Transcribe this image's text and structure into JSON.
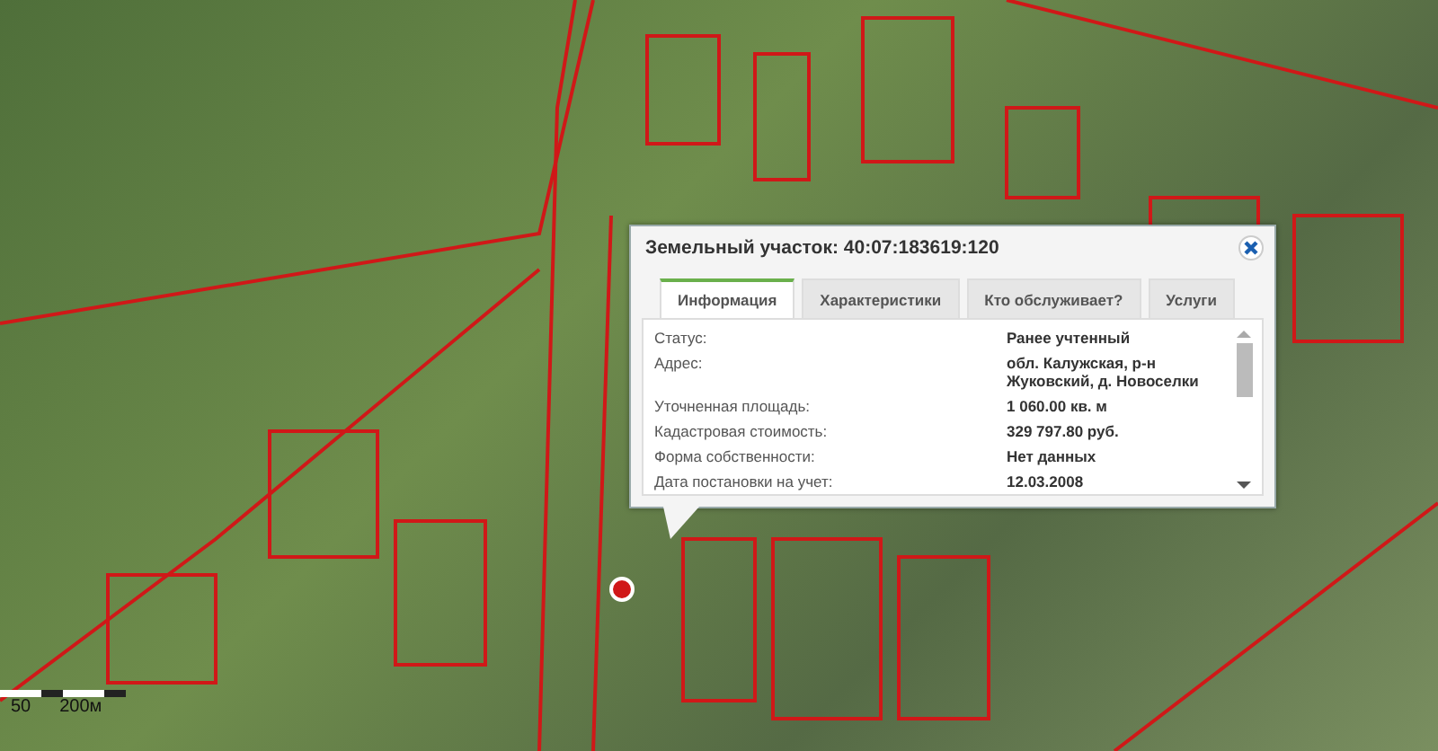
{
  "popup": {
    "title": "Земельный участок: 40:07:183619:120",
    "tabs": [
      {
        "label": "Информация",
        "selected": true
      },
      {
        "label": "Характеристики",
        "selected": false
      },
      {
        "label": "Кто обслуживает?",
        "selected": false
      },
      {
        "label": "Услуги",
        "selected": false
      }
    ],
    "rows": [
      {
        "label": "Статус:",
        "value": "Ранее учтенный"
      },
      {
        "label": "Адрес:",
        "value": "обл. Калужская, р-н Жуковский, д. Новоселки"
      },
      {
        "label": "Уточненная площадь:",
        "value": "1 060.00 кв. м"
      },
      {
        "label": "Кадастровая стоимость:",
        "value": "329 797.80 руб."
      },
      {
        "label": "Форма собственности:",
        "value": "Нет данных"
      },
      {
        "label": "Дата постановки на учет:",
        "value": "12.03.2008"
      }
    ]
  },
  "scale_bar": {
    "labels": [
      "50",
      "200м"
    ]
  }
}
